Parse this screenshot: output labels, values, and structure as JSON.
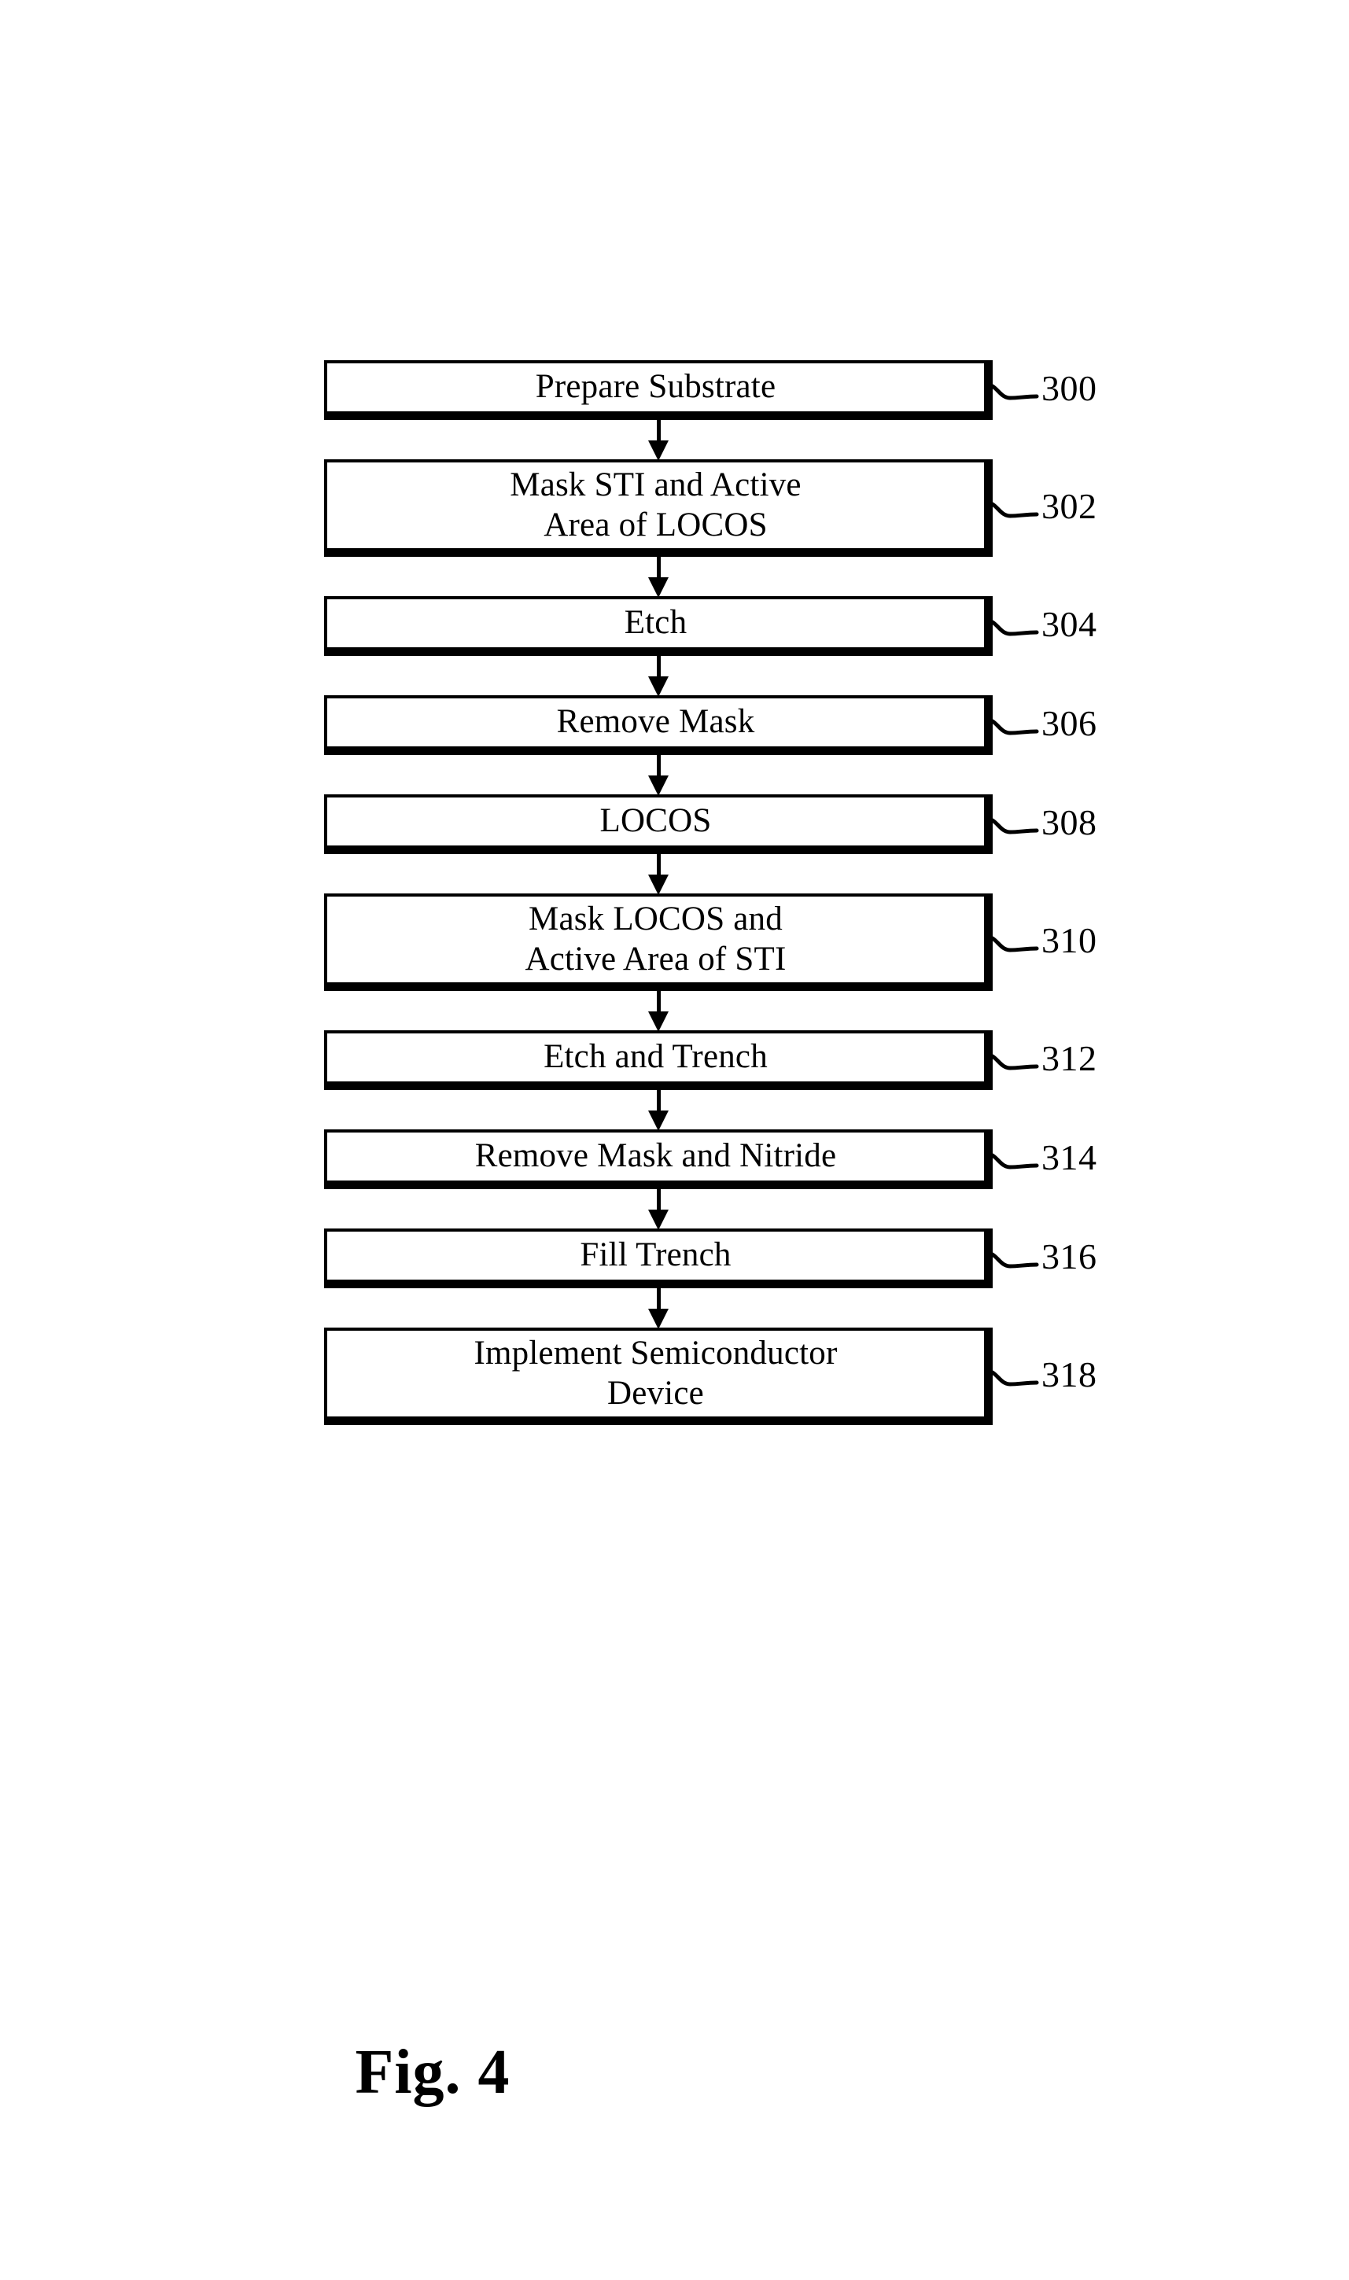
{
  "figure": {
    "caption": "Fig. 4",
    "type": "process-flowchart",
    "orientation": "vertical top-to-bottom",
    "steps": [
      {
        "ref": "300",
        "label": "Prepare Substrate",
        "lines": 1
      },
      {
        "ref": "302",
        "label": "Mask STI and Active\nArea of LOCOS",
        "lines": 2
      },
      {
        "ref": "304",
        "label": "Etch",
        "lines": 1
      },
      {
        "ref": "306",
        "label": "Remove Mask",
        "lines": 1
      },
      {
        "ref": "308",
        "label": "LOCOS",
        "lines": 1
      },
      {
        "ref": "310",
        "label": "Mask LOCOS and\nActive Area of STI",
        "lines": 2
      },
      {
        "ref": "312",
        "label": "Etch and Trench",
        "lines": 1
      },
      {
        "ref": "314",
        "label": "Remove Mask and Nitride",
        "lines": 1
      },
      {
        "ref": "316",
        "label": "Fill Trench",
        "lines": 1
      },
      {
        "ref": "318",
        "label": "Implement Semiconductor\nDevice",
        "lines": 2
      }
    ],
    "connector": "downward-arrow",
    "colors": {
      "ink": "#000000",
      "paper": "#ffffff"
    }
  }
}
